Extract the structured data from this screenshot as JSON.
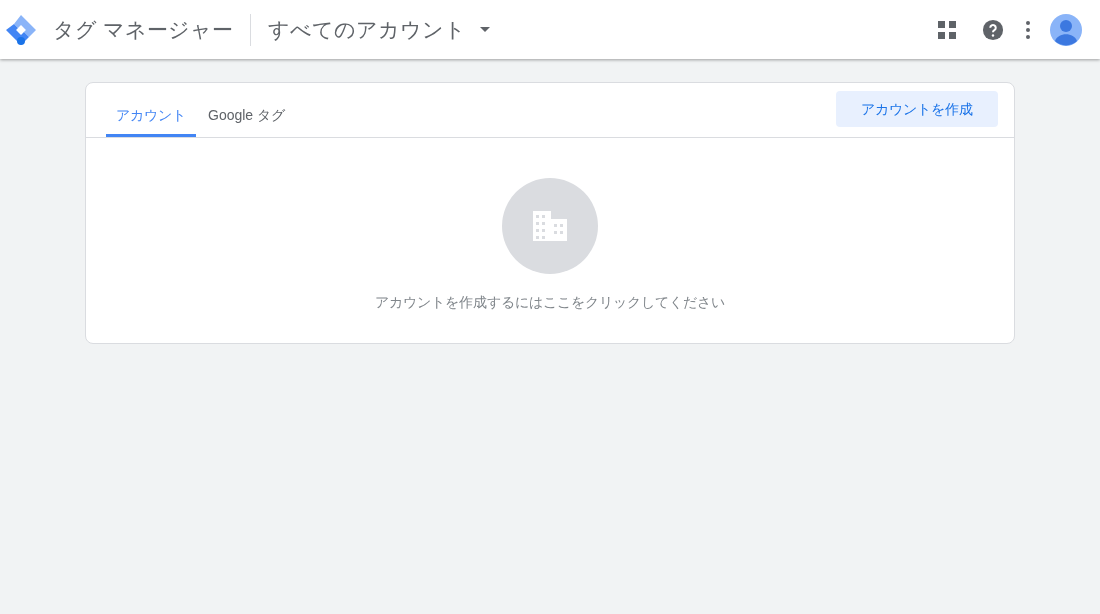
{
  "header": {
    "product_name": "タグ マネージャー",
    "account_selector": "すべてのアカウント"
  },
  "tabs": [
    {
      "label": "アカウント",
      "selected": true
    },
    {
      "label": "Google タグ",
      "selected": false
    }
  ],
  "create_button": "アカウントを作成",
  "empty_state": {
    "message": "アカウントを作成するにはここをクリックしてください"
  }
}
